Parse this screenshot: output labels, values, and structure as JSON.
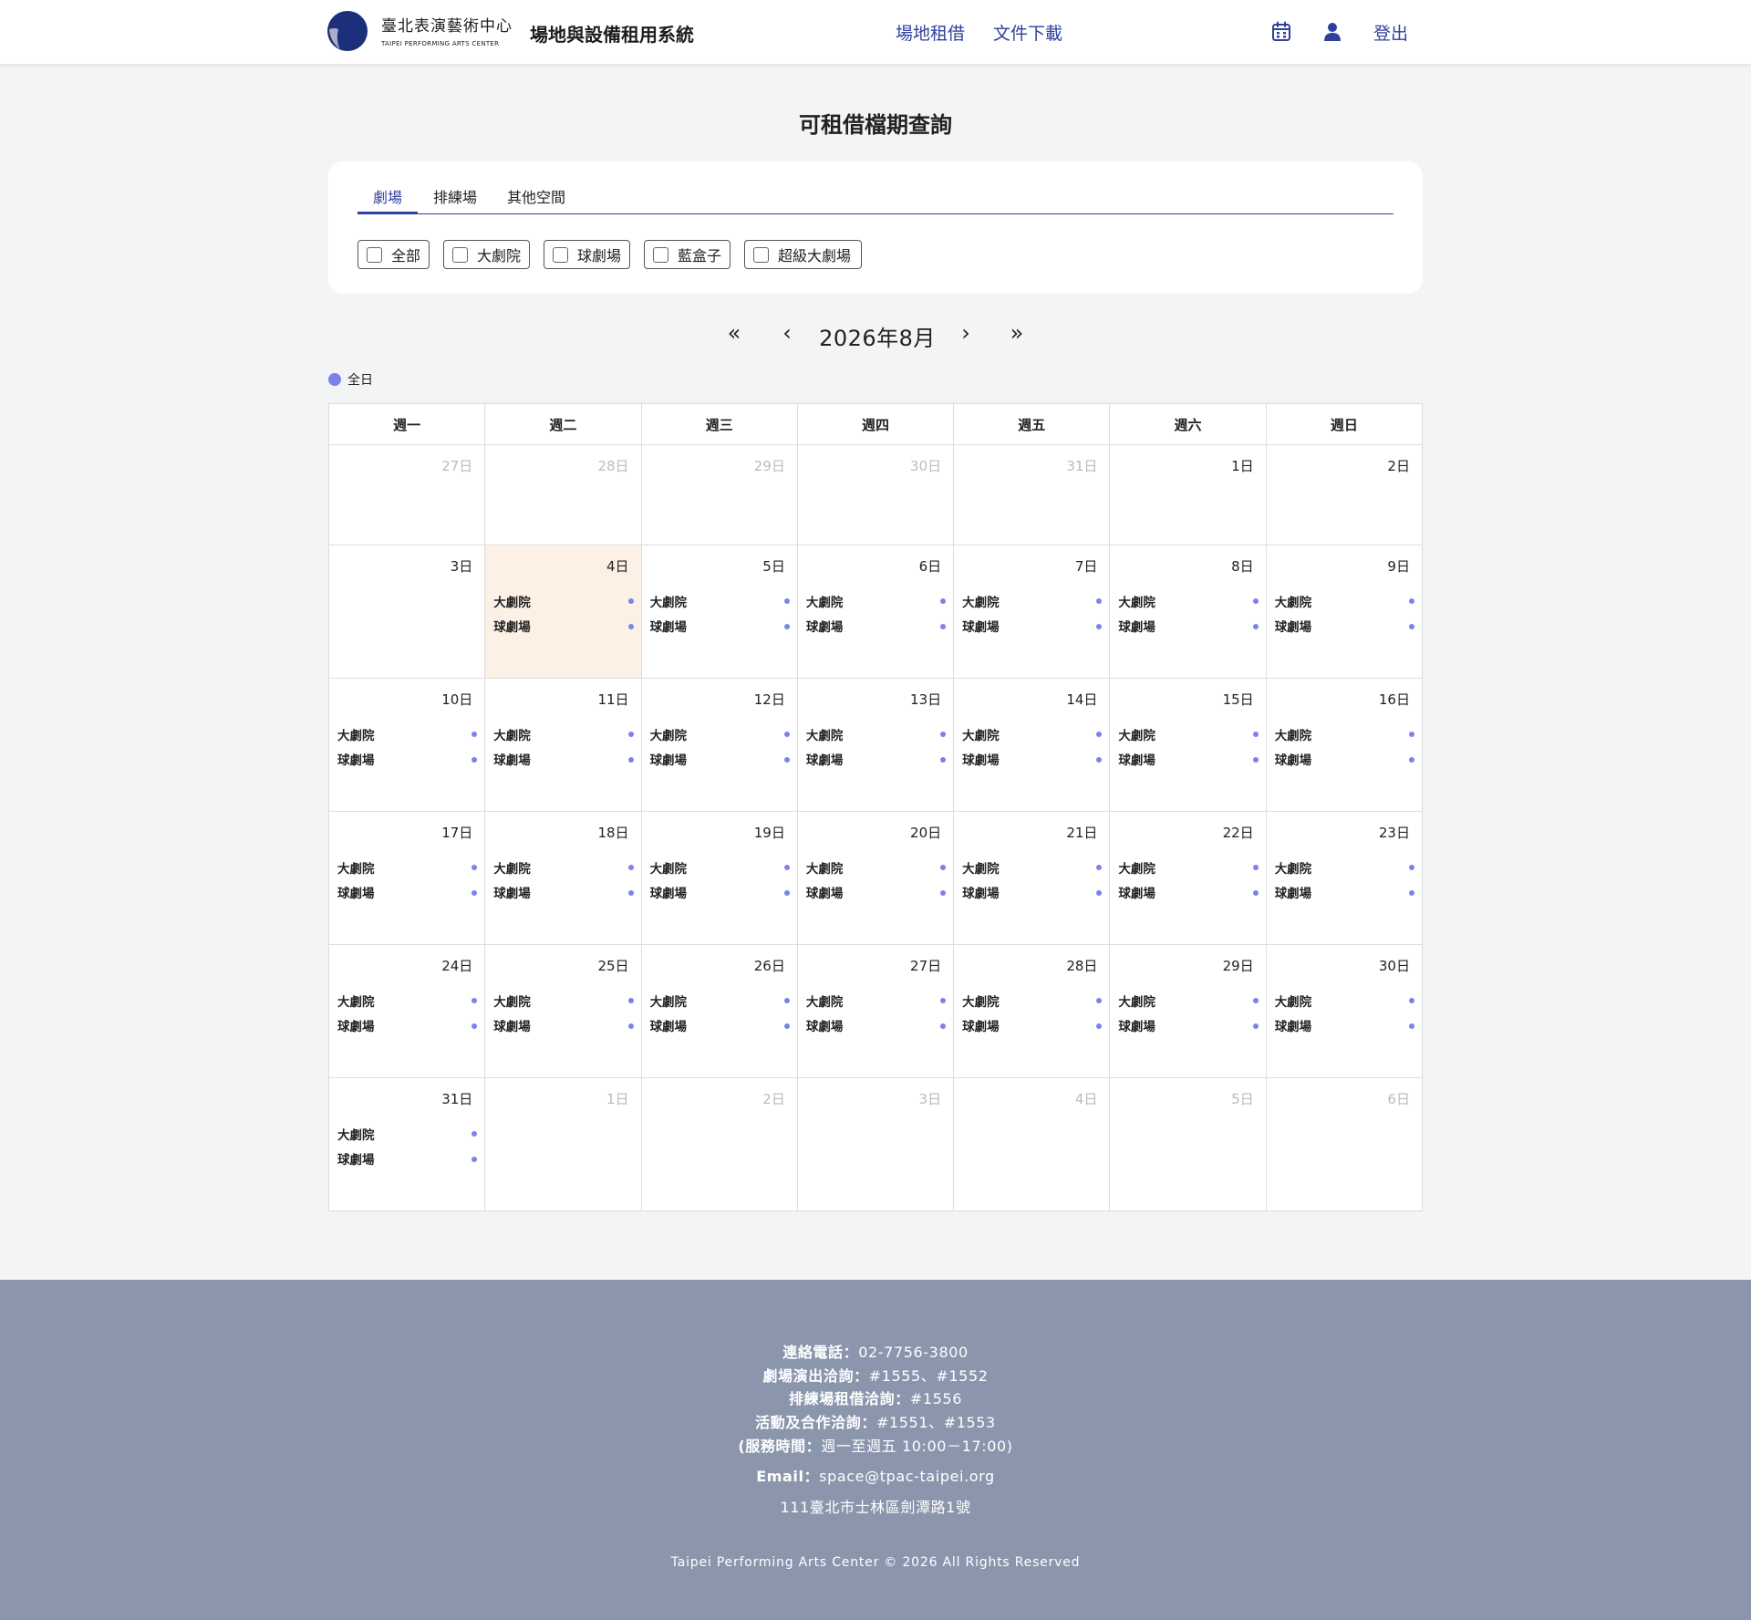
{
  "header": {
    "logo_zh": "臺北表演藝術中心",
    "logo_en": "TAIPEI PERFORMING ARTS CENTER",
    "system_title": "場地與設備租用系統",
    "nav": [
      "場地租借",
      "文件下載"
    ],
    "icons": [
      "calendar-icon",
      "user-icon"
    ],
    "logout": "登出"
  },
  "page_title": "可租借檔期查詢",
  "tabs": [
    "劇場",
    "排練場",
    "其他空間"
  ],
  "active_tab": 0,
  "filters": [
    {
      "label": "全部",
      "checked": false
    },
    {
      "label": "大劇院",
      "checked": false
    },
    {
      "label": "球劇場",
      "checked": false
    },
    {
      "label": "藍盒子",
      "checked": false
    },
    {
      "label": "超級大劇場",
      "checked": false
    }
  ],
  "month_nav": {
    "first": "«",
    "prev": "‹",
    "label": "2026年8月",
    "next": "›",
    "last": "»"
  },
  "legend": {
    "label": "全日",
    "color": "#7b83eb"
  },
  "weekdays": [
    "週一",
    "週二",
    "週三",
    "週四",
    "週五",
    "週六",
    "週日"
  ],
  "weeks": [
    [
      {
        "day": "27日",
        "other": true,
        "venues": []
      },
      {
        "day": "28日",
        "other": true,
        "venues": []
      },
      {
        "day": "29日",
        "other": true,
        "venues": []
      },
      {
        "day": "30日",
        "other": true,
        "venues": []
      },
      {
        "day": "31日",
        "other": true,
        "venues": []
      },
      {
        "day": "1日",
        "other": false,
        "venues": []
      },
      {
        "day": "2日",
        "other": false,
        "venues": []
      }
    ],
    [
      {
        "day": "3日",
        "other": false,
        "venues": []
      },
      {
        "day": "4日",
        "other": false,
        "today": true,
        "venues": [
          "大劇院",
          "球劇場"
        ]
      },
      {
        "day": "5日",
        "other": false,
        "venues": [
          "大劇院",
          "球劇場"
        ]
      },
      {
        "day": "6日",
        "other": false,
        "venues": [
          "大劇院",
          "球劇場"
        ]
      },
      {
        "day": "7日",
        "other": false,
        "venues": [
          "大劇院",
          "球劇場"
        ]
      },
      {
        "day": "8日",
        "other": false,
        "venues": [
          "大劇院",
          "球劇場"
        ]
      },
      {
        "day": "9日",
        "other": false,
        "venues": [
          "大劇院",
          "球劇場"
        ]
      }
    ],
    [
      {
        "day": "10日",
        "other": false,
        "venues": [
          "大劇院",
          "球劇場"
        ]
      },
      {
        "day": "11日",
        "other": false,
        "venues": [
          "大劇院",
          "球劇場"
        ]
      },
      {
        "day": "12日",
        "other": false,
        "venues": [
          "大劇院",
          "球劇場"
        ]
      },
      {
        "day": "13日",
        "other": false,
        "venues": [
          "大劇院",
          "球劇場"
        ]
      },
      {
        "day": "14日",
        "other": false,
        "venues": [
          "大劇院",
          "球劇場"
        ]
      },
      {
        "day": "15日",
        "other": false,
        "venues": [
          "大劇院",
          "球劇場"
        ]
      },
      {
        "day": "16日",
        "other": false,
        "venues": [
          "大劇院",
          "球劇場"
        ]
      }
    ],
    [
      {
        "day": "17日",
        "other": false,
        "venues": [
          "大劇院",
          "球劇場"
        ]
      },
      {
        "day": "18日",
        "other": false,
        "venues": [
          "大劇院",
          "球劇場"
        ]
      },
      {
        "day": "19日",
        "other": false,
        "venues": [
          "大劇院",
          "球劇場"
        ]
      },
      {
        "day": "20日",
        "other": false,
        "venues": [
          "大劇院",
          "球劇場"
        ]
      },
      {
        "day": "21日",
        "other": false,
        "venues": [
          "大劇院",
          "球劇場"
        ]
      },
      {
        "day": "22日",
        "other": false,
        "venues": [
          "大劇院",
          "球劇場"
        ]
      },
      {
        "day": "23日",
        "other": false,
        "venues": [
          "大劇院",
          "球劇場"
        ]
      }
    ],
    [
      {
        "day": "24日",
        "other": false,
        "venues": [
          "大劇院",
          "球劇場"
        ]
      },
      {
        "day": "25日",
        "other": false,
        "venues": [
          "大劇院",
          "球劇場"
        ]
      },
      {
        "day": "26日",
        "other": false,
        "venues": [
          "大劇院",
          "球劇場"
        ]
      },
      {
        "day": "27日",
        "other": false,
        "venues": [
          "大劇院",
          "球劇場"
        ]
      },
      {
        "day": "28日",
        "other": false,
        "venues": [
          "大劇院",
          "球劇場"
        ]
      },
      {
        "day": "29日",
        "other": false,
        "venues": [
          "大劇院",
          "球劇場"
        ]
      },
      {
        "day": "30日",
        "other": false,
        "venues": [
          "大劇院",
          "球劇場"
        ]
      }
    ],
    [
      {
        "day": "31日",
        "other": false,
        "venues": [
          "大劇院",
          "球劇場"
        ]
      },
      {
        "day": "1日",
        "other": true,
        "venues": []
      },
      {
        "day": "2日",
        "other": true,
        "venues": []
      },
      {
        "day": "3日",
        "other": true,
        "venues": []
      },
      {
        "day": "4日",
        "other": true,
        "venues": []
      },
      {
        "day": "5日",
        "other": true,
        "venues": []
      },
      {
        "day": "6日",
        "other": true,
        "venues": []
      }
    ]
  ],
  "footer": {
    "phone_label": "連絡電話：",
    "phone_value": "02-7756-3800",
    "theater_label": "劇場演出洽詢：",
    "theater_value": "#1555、#1552",
    "rehearsal_label": "排練場租借洽詢：",
    "rehearsal_value": "#1556",
    "events_label": "活動及合作洽詢：",
    "events_value": "#1551、#1553",
    "hours_label": "(服務時間：",
    "hours_value": "週一至週五 10:00－17:00)",
    "email_label": "Email：",
    "email_value": "space@tpac-taipei.org",
    "address": "111臺北市士林區劍潭路1號",
    "copyright": "Taipei Performing Arts Center © 2026 All Rights Reserved"
  }
}
